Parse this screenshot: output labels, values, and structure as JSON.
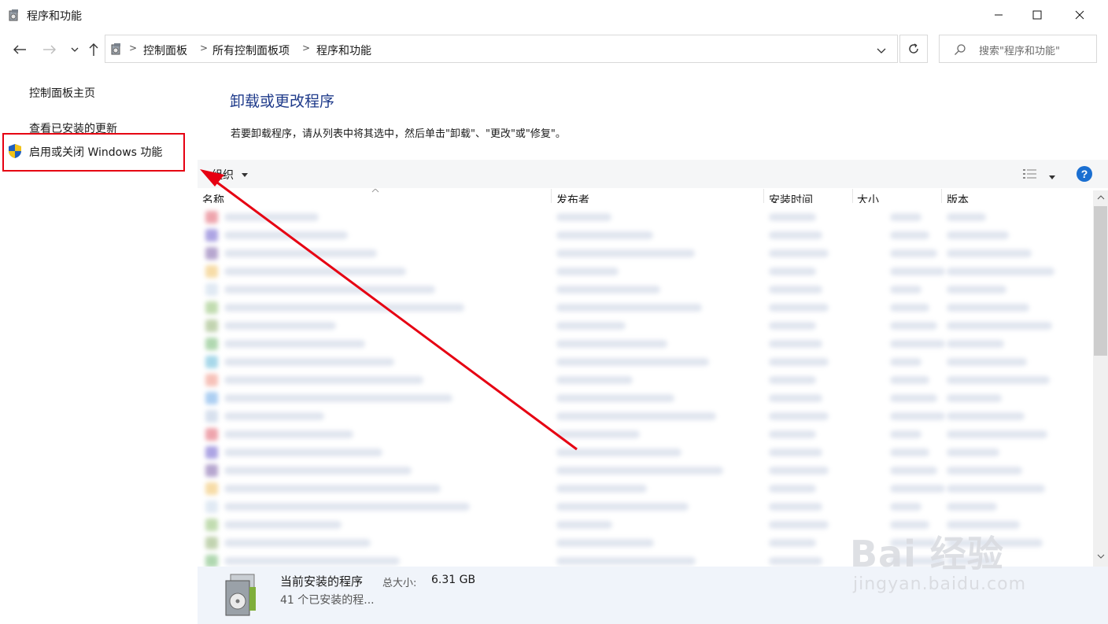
{
  "window": {
    "title": "程序和功能"
  },
  "nav": {
    "breadcrumbs": [
      "控制面板",
      "所有控制面板项",
      "程序和功能"
    ],
    "search_placeholder": "搜索\"程序和功能\""
  },
  "sidebar": {
    "items": [
      {
        "label": "控制面板主页"
      },
      {
        "label": "查看已安装的更新"
      },
      {
        "label": "启用或关闭 Windows 功能"
      }
    ]
  },
  "main": {
    "heading": "卸载或更改程序",
    "description": "若要卸载程序，请从列表中将其选中，然后单击\"卸载\"、\"更改\"或\"修复\"。",
    "organize": "组织",
    "columns": [
      "名称",
      "发布者",
      "安装时间",
      "大小",
      "版本"
    ]
  },
  "status": {
    "title": "当前安装的程序",
    "size_label": "总大小:",
    "size_value": "6.31 GB",
    "count": "41 个已安装的程..."
  },
  "watermark": {
    "brand": "Bai 经验",
    "url": "jingyan.baidu.com"
  },
  "colors": {
    "accent": "#1e3a8a",
    "highlight_box": "#e60012",
    "arrow": "#e60012"
  }
}
